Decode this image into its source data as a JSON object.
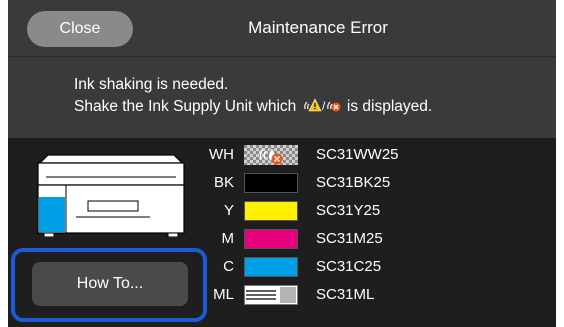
{
  "header": {
    "close_label": "Close",
    "title": "Maintenance Error"
  },
  "message": {
    "line1": "Ink shaking is needed.",
    "line2_before": "Shake the Ink Supply Unit which",
    "line2_after": "is displayed."
  },
  "inks": [
    {
      "code": "WH",
      "name": "SC31WW25",
      "swatch": "checkered-warning",
      "color": "#b0b0b0"
    },
    {
      "code": "BK",
      "name": "SC31BK25",
      "swatch": "solid",
      "color": "#000000"
    },
    {
      "code": "Y",
      "name": "SC31Y25",
      "swatch": "solid",
      "color": "#fff000"
    },
    {
      "code": "M",
      "name": "SC31M25",
      "swatch": "solid",
      "color": "#e6007e"
    },
    {
      "code": "C",
      "name": "SC31C25",
      "swatch": "solid",
      "color": "#00a0e9"
    },
    {
      "code": "ML",
      "name": "SC31ML",
      "swatch": "maintenance",
      "color": "#ffffff"
    }
  ],
  "howto": {
    "label": "How To..."
  },
  "colors": {
    "panel": "#3a3a3a",
    "background": "#1e1e1e",
    "highlight": "#1f5ad6",
    "printer_cyan": "#00a0e9"
  }
}
